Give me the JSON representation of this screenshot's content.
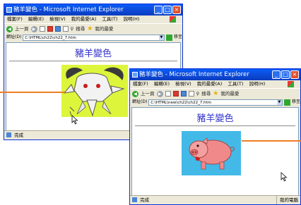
{
  "window_title": "豬羊變色 - Microsoft Internet Explorer",
  "menu": [
    "檔案(F)",
    "編輯(E)",
    "檢視(V)",
    "我的最愛(A)",
    "工具(T)",
    "說明(H)"
  ],
  "toolbar": {
    "back": "上一頁",
    "search": "搜尋",
    "favorites": "我的最愛"
  },
  "window1": {
    "address_label": "網址(D)",
    "address": "C:\\HTML\\ch22\\ch22_7.htm",
    "go": "移至"
  },
  "window2": {
    "address_label": "網址(D)",
    "address": "C:\\HTML\\new\\ch22\\ch22_7.htm",
    "go": "移至"
  },
  "page_heading": "豬羊變色",
  "status_done": "完成",
  "status_zone": "我的電腦",
  "colors": {
    "callout": "#ef7d22",
    "heading": "#3333cc",
    "goat_bg": "#ddf53a",
    "pig_bg": "#43b9e8",
    "titlebar": "#0a5df7"
  },
  "images": {
    "window1": "goat-picture",
    "window2": "pig-picture"
  }
}
